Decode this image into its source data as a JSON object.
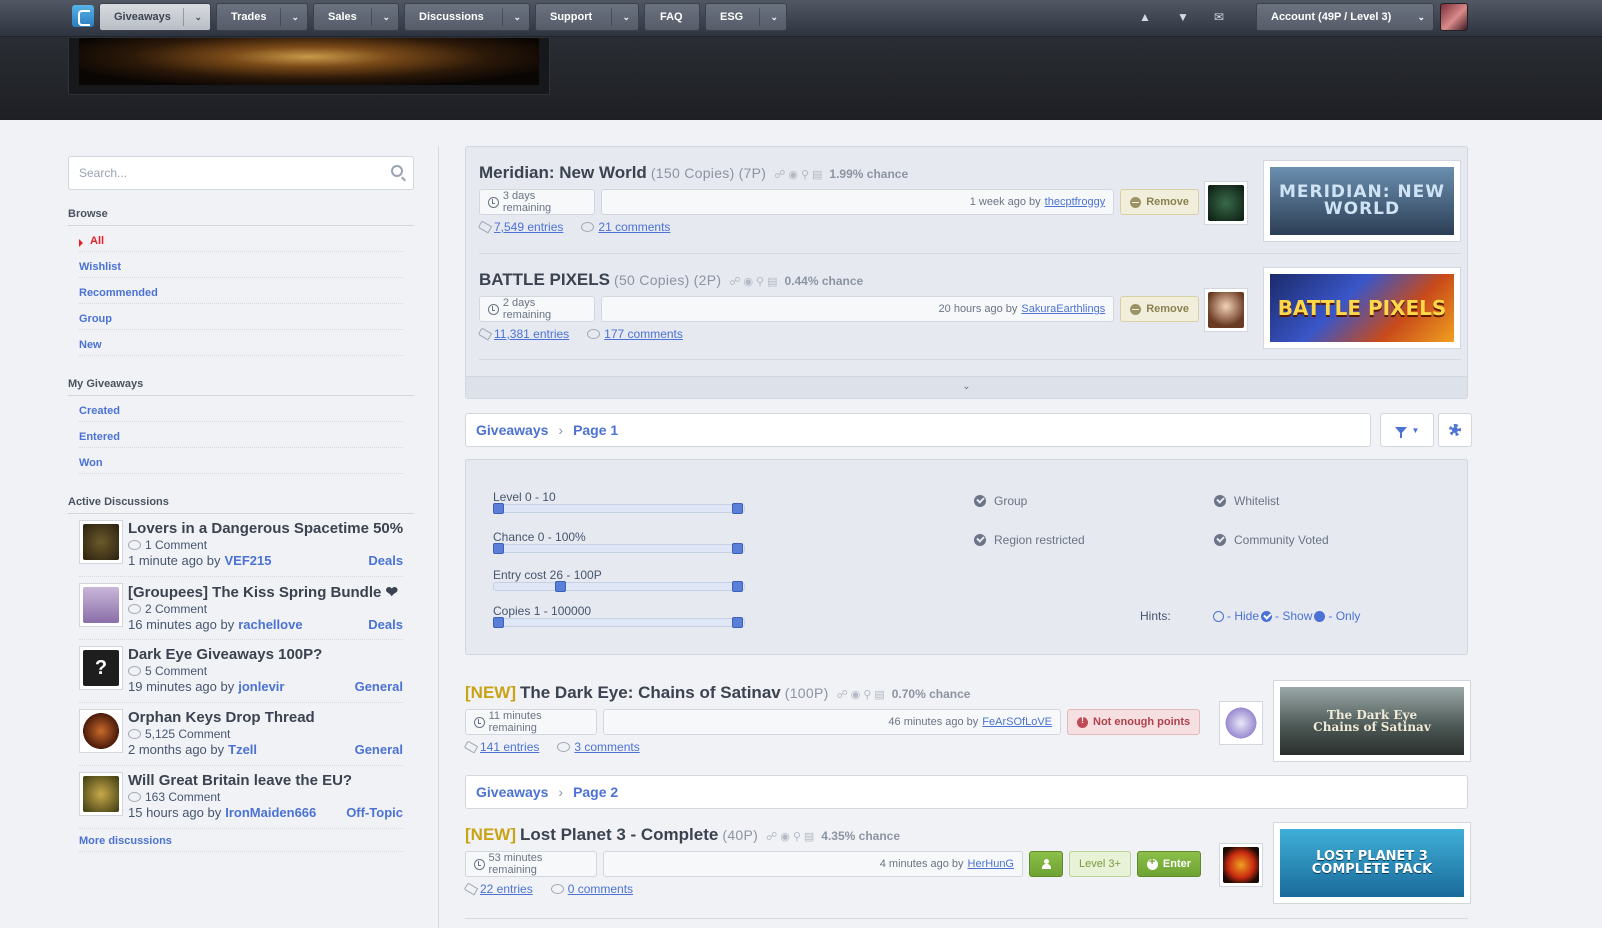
{
  "nav": {
    "items": [
      {
        "label": "Giveaways",
        "active": true
      },
      {
        "label": "Trades"
      },
      {
        "label": "Sales"
      },
      {
        "label": "Discussions"
      },
      {
        "label": "Support"
      },
      {
        "label": "FAQ"
      },
      {
        "label": "ESG"
      }
    ],
    "icons": [
      "gift-icon",
      "trophy-icon",
      "envelope-icon"
    ],
    "account": "Account (49P / Level 3)"
  },
  "sidebar": {
    "search_placeholder": "Search...",
    "browse_head": "Browse",
    "browse": [
      "All",
      "Wishlist",
      "Recommended",
      "Group",
      "New"
    ],
    "mygiveaways_head": "My Giveaways",
    "mygiveaways": [
      "Created",
      "Entered",
      "Won"
    ],
    "discussions_head": "Active Discussions",
    "discussions": [
      {
        "title": "Lovers in a Dangerous Spacetime 50%",
        "comments": "1 Comment",
        "time": "1 minute ago by",
        "user": "VEF215",
        "category": "Deals"
      },
      {
        "title": "[Groupees] The Kiss Spring Bundle ❤",
        "comments": "2 Comment",
        "time": "16 minutes ago by",
        "user": "rachellove",
        "category": "Deals"
      },
      {
        "title": "Dark Eye Giveaways 100P?",
        "comments": "5 Comment",
        "time": "19 minutes ago by",
        "user": "jonlevir",
        "category": "General"
      },
      {
        "title": "Orphan Keys Drop Thread",
        "comments": "5,125 Comment",
        "time": "2 months ago by",
        "user": "Tzell",
        "category": "General"
      },
      {
        "title": "Will Great Britain leave the EU?",
        "comments": "163 Comment",
        "time": "15 hours ago by",
        "user": "IronMaiden666",
        "category": "Off-Topic"
      }
    ],
    "more": "More discussions"
  },
  "pinned": [
    {
      "name": "Meridian: New World",
      "copies": "(150 Copies)",
      "points": "(7P)",
      "chance": "1.99% chance",
      "remaining": "3 days remaining",
      "time": "1 week ago by",
      "user": "thecptfroggy",
      "action": "Remove",
      "entries": "7,549 entries",
      "comments": "21 comments",
      "image_text": "MERIDIAN: NEW WORLD"
    },
    {
      "name": "BATTLE PIXELS",
      "copies": "(50 Copies)",
      "points": "(2P)",
      "chance": "0.44% chance",
      "remaining": "2 days remaining",
      "time": "20 hours ago by",
      "user": "SakuraEarthlings",
      "action": "Remove",
      "entries": "11,381 entries",
      "comments": "177 comments",
      "image_text": "BATTLE PIXELS"
    }
  ],
  "breadcrumb1": {
    "root": "Giveaways",
    "page": "Page 1"
  },
  "filters": {
    "sliders": [
      {
        "label": "Level 0 - 10",
        "lo": 0,
        "hi": 1
      },
      {
        "label": "Chance 0 - 100%",
        "lo": 0,
        "hi": 1
      },
      {
        "label": "Entry cost 26 - 100P",
        "lo": 0.26,
        "hi": 1
      },
      {
        "label": "Copies 1 - 100000",
        "lo": 0,
        "hi": 1
      }
    ],
    "options": [
      "Group",
      "Whitelist",
      "Region restricted",
      "Community Voted"
    ],
    "hints_label": "Hints:",
    "hint_hide": "- Hide",
    "hint_show": "- Show",
    "hint_only": "- Only"
  },
  "giveaways": [
    {
      "new": "[NEW]",
      "name": "The Dark Eye: Chains of Satinav",
      "points": "(100P)",
      "chance": "0.70% chance",
      "remaining": "11 minutes remaining",
      "time": "46 minutes ago by",
      "user": "FeArSOfLoVE",
      "action": "Not enough points",
      "entries": "141 entries",
      "comments": "3 comments",
      "image_text": "The Dark Eye Chains of Satinav"
    },
    {
      "new": "[NEW]",
      "name": "Lost Planet 3 - Complete",
      "points": "(40P)",
      "chance": "4.35% chance",
      "remaining": "53 minutes remaining",
      "time": "4 minutes ago by",
      "user": "HerHunG",
      "level": "Level 3+",
      "action": "Enter",
      "entries": "22 entries",
      "comments": "0 comments",
      "image_text": "LOST PLANET 3 COMPLETE PACK"
    }
  ],
  "breadcrumb2": {
    "root": "Giveaways",
    "page": "Page 2"
  }
}
